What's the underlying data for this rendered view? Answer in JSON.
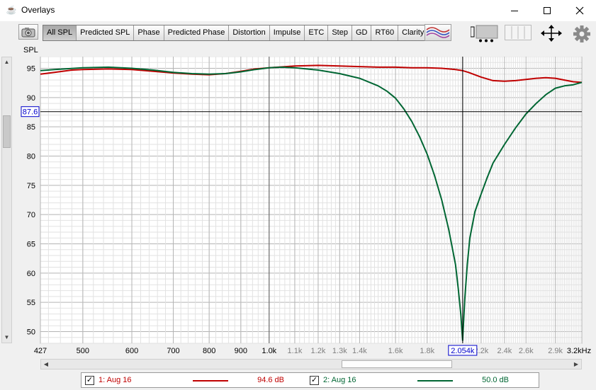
{
  "window": {
    "title": "Overlays",
    "icon": "java-cup-icon"
  },
  "toolbar": {
    "tabs": [
      {
        "label": "All SPL",
        "active": true
      },
      {
        "label": "Predicted SPL"
      },
      {
        "label": "Phase"
      },
      {
        "label": "Predicted Phase"
      },
      {
        "label": "Distortion"
      },
      {
        "label": "Impulse"
      },
      {
        "label": "ETC"
      },
      {
        "label": "Step"
      },
      {
        "label": "GD"
      },
      {
        "label": "RT60"
      },
      {
        "label": "Clarity"
      }
    ]
  },
  "chart_data": {
    "type": "line",
    "ylabel": "SPL",
    "xlabel": "",
    "x_scale": "log",
    "xlim": [
      427,
      3200
    ],
    "ylim": [
      48,
      97
    ],
    "x_ticks": [
      {
        "v": 427,
        "label": "427",
        "major": true
      },
      {
        "v": 500,
        "label": "500",
        "major": true
      },
      {
        "v": 600,
        "label": "600",
        "major": true
      },
      {
        "v": 700,
        "label": "700",
        "major": true
      },
      {
        "v": 800,
        "label": "800",
        "major": true
      },
      {
        "v": 900,
        "label": "900",
        "major": true
      },
      {
        "v": 1000,
        "label": "1.0k",
        "major": true
      },
      {
        "v": 1100,
        "label": "1.1k",
        "major": false
      },
      {
        "v": 1200,
        "label": "1.2k",
        "major": false
      },
      {
        "v": 1300,
        "label": "1.3k",
        "major": false
      },
      {
        "v": 1400,
        "label": "1.4k",
        "major": false
      },
      {
        "v": 1600,
        "label": "1.6k",
        "major": false
      },
      {
        "v": 1800,
        "label": "1.8k",
        "major": false
      },
      {
        "v": 2200,
        "label": "2.2k",
        "major": false
      },
      {
        "v": 2400,
        "label": "2.4k",
        "major": false
      },
      {
        "v": 2600,
        "label": "2.6k",
        "major": false
      },
      {
        "v": 2900,
        "label": "2.9k",
        "major": false
      },
      {
        "v": 3200,
        "label": "3.2kHz",
        "major": true
      }
    ],
    "y_ticks": [
      95,
      90,
      85,
      80,
      75,
      70,
      65,
      60,
      55,
      50
    ],
    "cursor": {
      "x": 2054,
      "x_label": "2.054k",
      "y": 87.6,
      "y_label": "87.6"
    },
    "grid": true,
    "series": [
      {
        "name": "1: Aug 16",
        "color": "#c00000",
        "x": [
          427,
          450,
          480,
          500,
          550,
          600,
          650,
          700,
          750,
          800,
          850,
          900,
          950,
          1000,
          1100,
          1200,
          1300,
          1400,
          1500,
          1600,
          1700,
          1800,
          1900,
          2000,
          2054,
          2100,
          2200,
          2300,
          2400,
          2500,
          2600,
          2700,
          2800,
          2900,
          3000,
          3100,
          3200
        ],
        "y": [
          94.0,
          94.3,
          94.7,
          94.8,
          94.9,
          94.8,
          94.5,
          94.2,
          94.0,
          93.9,
          94.1,
          94.5,
          94.9,
          95.1,
          95.4,
          95.5,
          95.4,
          95.3,
          95.2,
          95.2,
          95.1,
          95.1,
          95.0,
          94.8,
          94.6,
          94.3,
          93.5,
          92.9,
          92.8,
          92.9,
          93.1,
          93.3,
          93.4,
          93.3,
          93.0,
          92.7,
          92.6
        ]
      },
      {
        "name": "2: Aug 16",
        "color": "#006633",
        "x": [
          427,
          450,
          500,
          550,
          600,
          650,
          700,
          750,
          800,
          850,
          900,
          950,
          1000,
          1050,
          1100,
          1200,
          1300,
          1400,
          1500,
          1550,
          1600,
          1650,
          1700,
          1750,
          1800,
          1850,
          1900,
          1950,
          2000,
          2020,
          2040,
          2054,
          2070,
          2090,
          2110,
          2150,
          2200,
          2250,
          2300,
          2400,
          2500,
          2600,
          2700,
          2800,
          2900,
          3000,
          3100,
          3200
        ],
        "y": [
          94.6,
          94.8,
          95.1,
          95.2,
          95.0,
          94.7,
          94.3,
          94.1,
          94.0,
          94.1,
          94.4,
          94.8,
          95.1,
          95.2,
          95.1,
          94.7,
          94.1,
          93.3,
          92.0,
          91.1,
          89.9,
          88.1,
          85.9,
          83.3,
          80.3,
          76.7,
          72.5,
          67.5,
          61.5,
          57.5,
          53.0,
          48.5,
          55.5,
          61.5,
          66.0,
          70.5,
          73.5,
          76.3,
          78.8,
          82.0,
          84.8,
          87.2,
          89.0,
          90.5,
          91.6,
          92.0,
          92.2,
          92.6
        ]
      }
    ]
  },
  "legend": {
    "items": [
      {
        "name": "1: Aug 16",
        "value": "94.6 dB",
        "checked": true,
        "check": "✓"
      },
      {
        "name": "2: Aug 16",
        "value": "50.0 dB",
        "checked": true,
        "check": "✓"
      }
    ]
  }
}
